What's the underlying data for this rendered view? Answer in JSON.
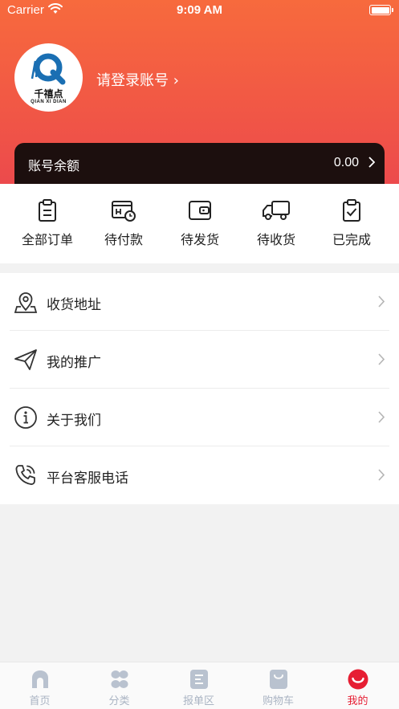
{
  "status_bar": {
    "carrier": "Carrier",
    "time": "9:09 AM"
  },
  "profile": {
    "logo_name": "千禧点",
    "logo_sub": "QIAN XI DIAN",
    "login_text": "请登录账号 ›"
  },
  "balance": {
    "label": "账号余额",
    "value": "0.00"
  },
  "orders": [
    {
      "label": "全部订单",
      "icon": "clipboard-list-icon"
    },
    {
      "label": "待付款",
      "icon": "wallet-clock-icon"
    },
    {
      "label": "待发货",
      "icon": "wallet-icon"
    },
    {
      "label": "待收货",
      "icon": "truck-icon"
    },
    {
      "label": "已完成",
      "icon": "clipboard-check-icon"
    }
  ],
  "menu": [
    {
      "label": "收货地址",
      "icon": "location-pin-icon"
    },
    {
      "label": "我的推广",
      "icon": "paper-plane-icon"
    },
    {
      "label": "关于我们",
      "icon": "info-icon"
    },
    {
      "label": "平台客服电话",
      "icon": "phone-icon"
    }
  ],
  "tabs": [
    {
      "label": "首页",
      "icon": "home-icon"
    },
    {
      "label": "分类",
      "icon": "category-icon"
    },
    {
      "label": "报单区",
      "icon": "list-icon"
    },
    {
      "label": "购物车",
      "icon": "cart-icon"
    },
    {
      "label": "我的",
      "icon": "profile-smile-icon",
      "active": true
    }
  ],
  "colors": {
    "header_top": "#f76a3d",
    "header_bottom": "#ec4a4c",
    "active_tab": "#e61e33",
    "inactive_tab": "#aab4c3",
    "balance_bg": "#1c0f0e"
  }
}
